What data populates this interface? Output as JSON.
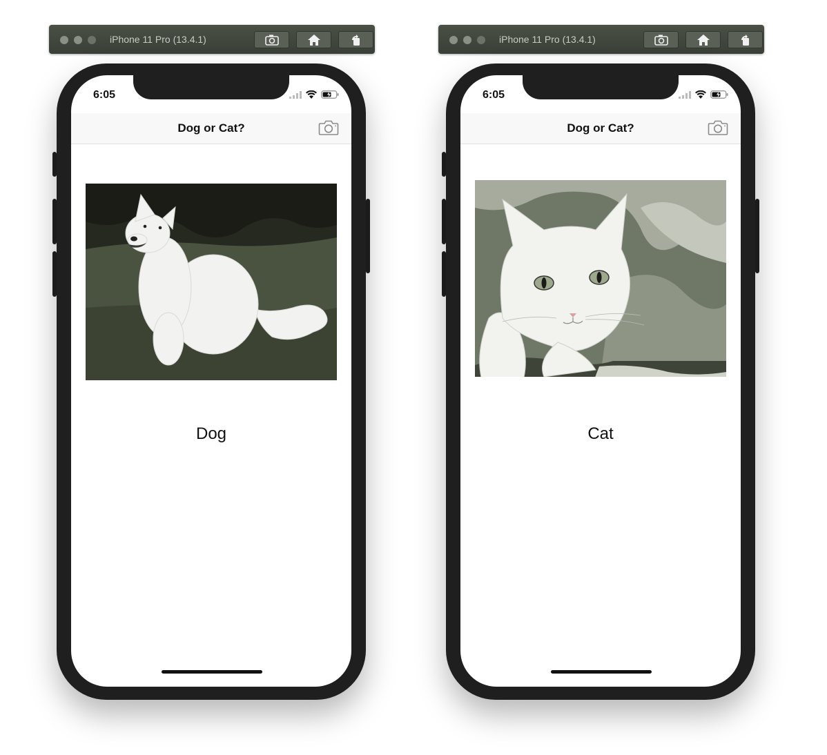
{
  "simulators": [
    {
      "window_title": "iPhone 11 Pro (13.4.1)",
      "status_time": "6:05",
      "nav_title": "Dog or Cat?",
      "result_label": "Dog",
      "photo_subject": "dog"
    },
    {
      "window_title": "iPhone 11 Pro (13.4.1)",
      "status_time": "6:05",
      "nav_title": "Dog or Cat?",
      "result_label": "Cat",
      "photo_subject": "cat"
    }
  ],
  "icons": {
    "toolbar": [
      "screenshot-icon",
      "home-icon",
      "rotate-icon"
    ],
    "status": [
      "cellular-icon",
      "wifi-icon",
      "battery-icon"
    ],
    "nav": [
      "camera-icon"
    ]
  },
  "colors": {
    "titlebar": "#3f443c",
    "phone_frame": "#1f1f1f",
    "navbar": "#f8f8f8"
  }
}
